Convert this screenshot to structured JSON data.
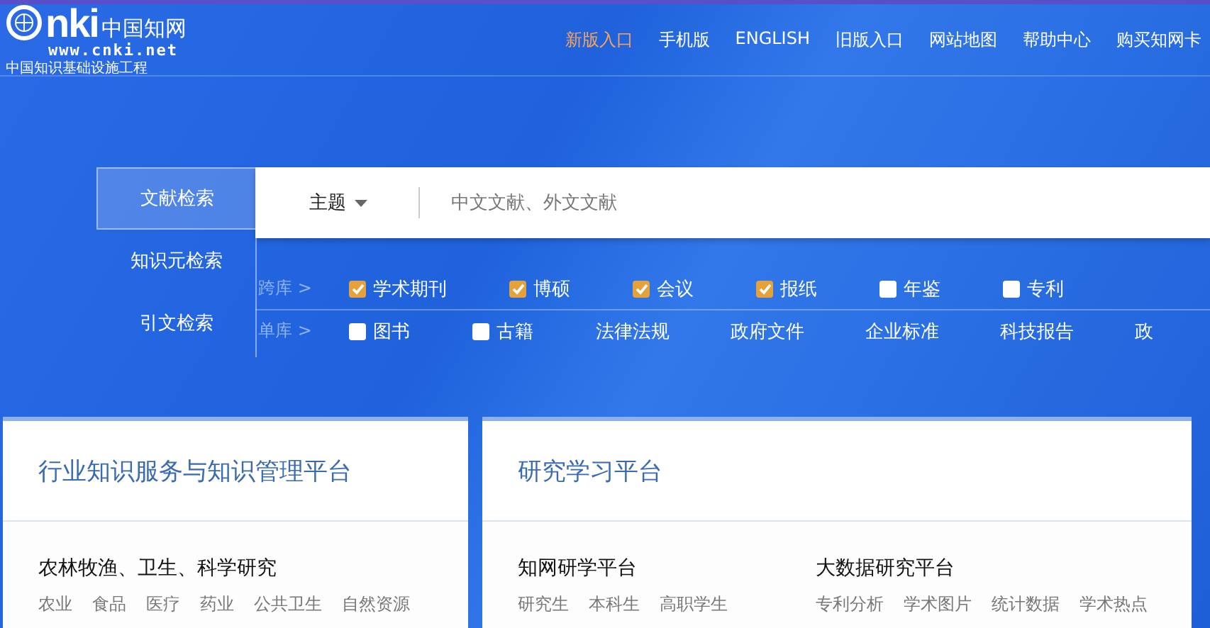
{
  "logo": {
    "mark": "nki",
    "name": "中国知网",
    "url": "www.cnki.net",
    "slogan": "中国知识基础设施工程"
  },
  "nav": [
    {
      "label": "新版入口",
      "selected": true
    },
    {
      "label": "手机版",
      "selected": false
    },
    {
      "label": "ENGLISH",
      "selected": false
    },
    {
      "label": "旧版入口",
      "selected": false
    },
    {
      "label": "网站地图",
      "selected": false
    },
    {
      "label": "帮助中心",
      "selected": false
    },
    {
      "label": "购买知网卡",
      "selected": false
    }
  ],
  "search_tabs": [
    {
      "label": "文献检索",
      "selected": true
    },
    {
      "label": "知识元检索",
      "selected": false
    },
    {
      "label": "引文检索",
      "selected": false
    }
  ],
  "search": {
    "field": "主题",
    "placeholder": "中文文献、外文文献"
  },
  "filter_rows": [
    {
      "label": "跨库 >",
      "items": [
        {
          "kind": "checkbox",
          "label": "学术期刊",
          "checked": true
        },
        {
          "kind": "checkbox",
          "label": "博硕",
          "checked": true
        },
        {
          "kind": "checkbox",
          "label": "会议",
          "checked": true
        },
        {
          "kind": "checkbox",
          "label": "报纸",
          "checked": true
        },
        {
          "kind": "checkbox",
          "label": "年鉴",
          "checked": false
        },
        {
          "kind": "checkbox",
          "label": "专利",
          "checked": false
        }
      ]
    },
    {
      "label": "单库 >",
      "items": [
        {
          "kind": "checkbox",
          "label": "图书",
          "checked": false
        },
        {
          "kind": "checkbox",
          "label": "古籍",
          "checked": false
        },
        {
          "kind": "link",
          "label": "法律法规"
        },
        {
          "kind": "link",
          "label": "政府文件"
        },
        {
          "kind": "link",
          "label": "企业标准"
        },
        {
          "kind": "link",
          "label": "科技报告"
        },
        {
          "kind": "link",
          "label": "政"
        }
      ]
    }
  ],
  "cards": [
    {
      "title": "行业知识服务与知识管理平台",
      "groups": [
        {
          "heading": "农林牧渔、卫生、科学研究",
          "tags": [
            "农业",
            "食品",
            "医疗",
            "药业",
            "公共卫生",
            "自然资源"
          ]
        }
      ]
    },
    {
      "title": "研究学习平台",
      "groups": [
        {
          "heading": "知网研学平台",
          "tags": [
            "研究生",
            "本科生",
            "高职学生"
          ]
        },
        {
          "heading": "大数据研究平台",
          "tags": [
            "专利分析",
            "学术图片",
            "统计数据",
            "学术热点"
          ]
        }
      ]
    }
  ]
}
